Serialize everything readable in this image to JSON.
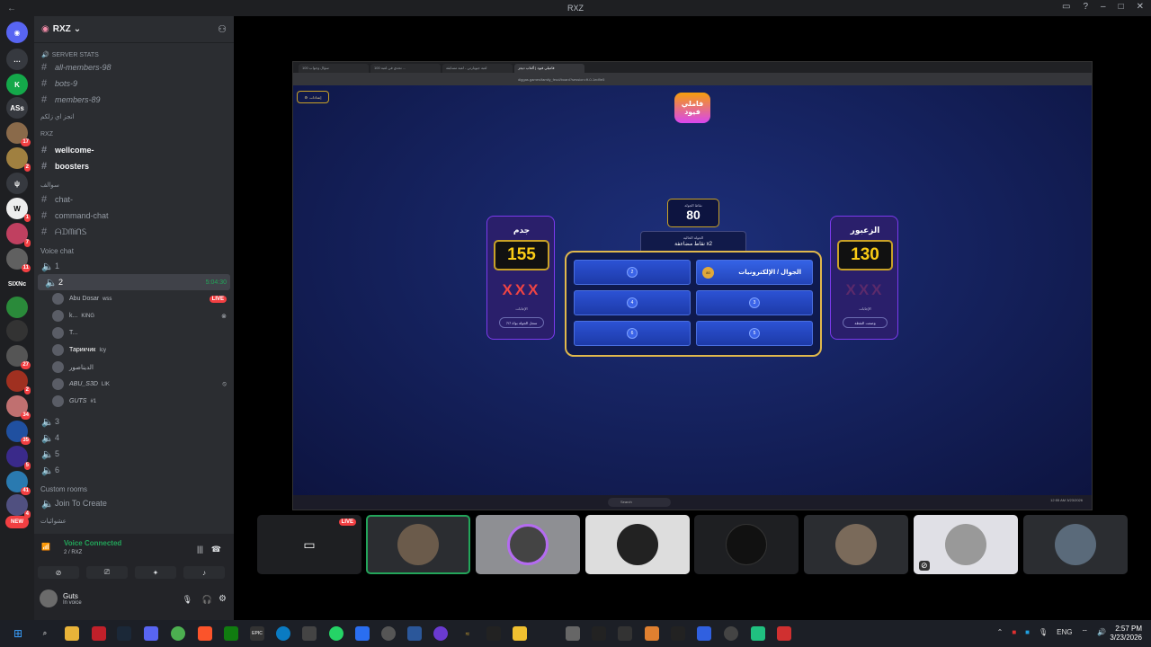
{
  "window": {
    "title": "RXZ"
  },
  "server": {
    "name": "RXZ"
  },
  "rail_badges": [
    "17",
    "2",
    "1",
    "7",
    "11",
    "27",
    "2",
    "34",
    "35",
    "5",
    "41",
    "4",
    "1"
  ],
  "rail_labels": {
    "ass": "ASs",
    "sixnc": "SIXNc",
    "new": "NEW"
  },
  "channels": {
    "server_stats": "SERVER STATS",
    "all_members": "all-members-98",
    "bots": "bots-9",
    "members": "members-89",
    "cat_arabic1": "انجز اي زلكم",
    "cat_rxz": "RXZ",
    "wellcome": "wellcome-",
    "boosters": "boosters",
    "cat_arabic2": "سوالف",
    "chat": "chat-",
    "command_chat": "command-chat",
    "styled": "ᗩᗪᗰᎥᑎᏚ",
    "voice_chat": "Voice chat",
    "v1": "1",
    "v2": "2",
    "v2_time": "5:04:30",
    "v3": "3",
    "v4": "4",
    "v5": "5",
    "v6": "6",
    "custom_rooms": "Custom rooms",
    "join_to_create": "Join To Create",
    "cat_arabic3": "عشوائيات"
  },
  "voice_users": [
    {
      "name": "Abu Dosar",
      "tag": "wss",
      "live": "LIVE"
    },
    {
      "name": "k...",
      "tag": "KING"
    },
    {
      "name": "T...",
      "tag": ""
    },
    {
      "name": "Тарикчик",
      "tag": "Icy"
    },
    {
      "name": "الديناصور",
      "tag": ""
    },
    {
      "name": "ABU_S3D",
      "tag": "LIK"
    },
    {
      "name": "GUTS",
      "tag": "#1"
    }
  ],
  "voice_bar": {
    "status": "Voice Connected",
    "sub": "2 / RXZ"
  },
  "user": {
    "name": "Guts",
    "status": "In voice"
  },
  "browser": {
    "tabs": [
      "فاميلي فيود | ألعاب ديجز",
      "لعبة جيوبارتي - لعبة مسابقة",
      "تحدي في لعبة 100 ...",
      "100 سؤال وجواب"
    ],
    "url": "diggas.games/family_feud/board?session=ff-0-1ed9e5"
  },
  "game": {
    "settings": "إعدادات",
    "logo": "فاملي فيود",
    "points_label": "نقاط الجولة",
    "points": "80",
    "double_label": "الجولة الحالية",
    "double": "نقاط مضاعفة x2",
    "team_left": {
      "name": "جدم",
      "score": "155",
      "label": "الإجابات",
      "btn": "سجل الجولة بواة 7/7"
    },
    "team_right": {
      "name": "الزعبور",
      "score": "130",
      "label": "الإجابات",
      "btn": "وضعت النقطة"
    },
    "strikes": "XXX",
    "answers": [
      {
        "num": "2"
      },
      {
        "text": "الجوال / الإلكترونيات",
        "pts": "80"
      },
      {
        "num": "4"
      },
      {
        "num": "3"
      },
      {
        "num": "6"
      },
      {
        "num": "5"
      }
    ]
  },
  "inner_taskbar": {
    "search": "Search",
    "time": "12:55 AM",
    "date": "3/23/2026"
  },
  "tiles": {
    "live": "LIVE"
  },
  "taskbar": {
    "lang": "ENG",
    "time": "2:57 PM",
    "date": "3/23/2026"
  }
}
